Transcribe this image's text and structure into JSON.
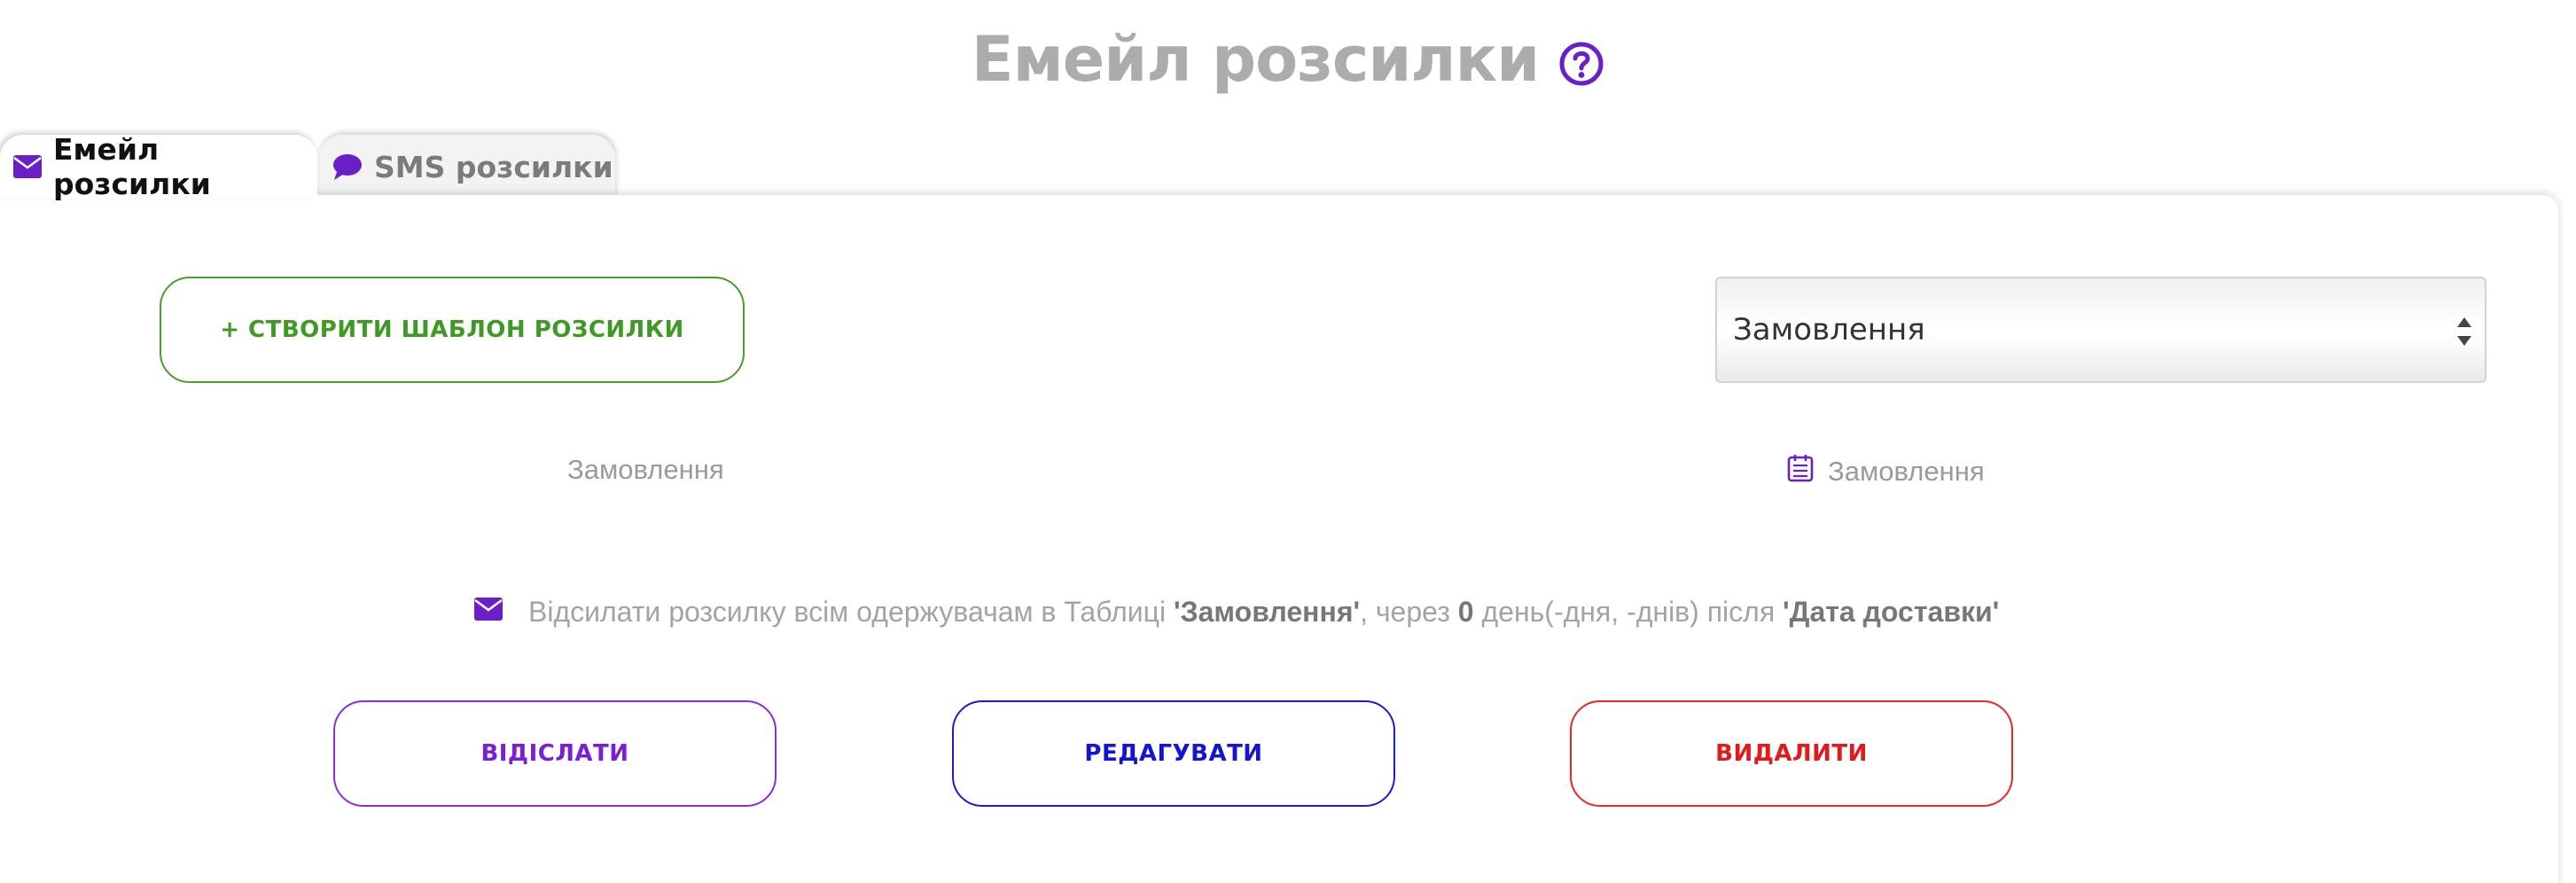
{
  "header": {
    "title": "Емейл розсилки",
    "help_icon": "question-circle-icon"
  },
  "tabs": [
    {
      "label": "Емейл розсилки",
      "icon": "envelope-icon",
      "active": true
    },
    {
      "label": "SMS розсилки",
      "icon": "comment-icon",
      "active": false
    }
  ],
  "toolbar": {
    "create_label": "+ СТВОРИТИ ШАБЛОН РОЗСИЛКИ",
    "select_value": "Замовлення"
  },
  "template_card": {
    "name": "Замовлення",
    "table_label": "Замовлення",
    "table_icon": "table-icon",
    "description": {
      "icon": "envelope-icon",
      "prefix": "Відсилати розсилку всім одержувачам в Таблиці",
      "table": "'Замовлення'",
      "middle": ", через",
      "days": "0",
      "suffix": "день(-дня, -днів) після",
      "field": "'Дата доставки'"
    },
    "actions": {
      "send_label": "ВІДІСЛАТИ",
      "edit_label": "РЕДАГУВАТИ",
      "delete_label": "ВИДАЛИТИ"
    }
  },
  "colors": {
    "accent": "#6a1fc9",
    "create": "#3f9a23",
    "send": "#7a1fd6",
    "edit": "#1414d4",
    "delete": "#e11b1b",
    "muted_text": "#9a9a9a"
  }
}
